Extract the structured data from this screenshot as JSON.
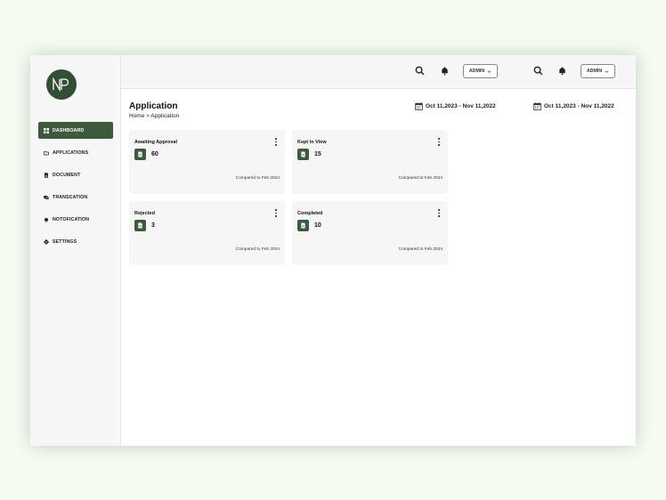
{
  "brand": {
    "logo_text": "NP",
    "accent_color": "#3d5a3c"
  },
  "sidebar": {
    "items": [
      {
        "label": "DASHBOARD",
        "icon": "dashboard-icon",
        "active": true
      },
      {
        "label": "APPLICATIONS",
        "icon": "folder-icon",
        "active": false
      },
      {
        "label": "DOCUMENT",
        "icon": "document-icon",
        "active": false
      },
      {
        "label": "TRANSCATION",
        "icon": "transaction-icon",
        "active": false
      },
      {
        "label": "NOTOFICATION",
        "icon": "bell-icon",
        "active": false
      },
      {
        "label": "SETTINGS",
        "icon": "gear-icon",
        "active": false
      }
    ]
  },
  "header": {
    "admin_label_1": "ADMIN",
    "admin_label_2": "ADMIN",
    "icons": [
      "search-icon",
      "bell-icon",
      "chevron-down-icon"
    ]
  },
  "page": {
    "title": "Application",
    "breadcrumb": "Home > Application",
    "date_range_1": "Oct 11,2023 - Nov 11,2022",
    "date_range_2": "Oct 11,2023 - Nov 11,2022"
  },
  "cards": [
    {
      "title": "Awaiting Approval",
      "value": "60",
      "compare": "Compared to Feb 2024"
    },
    {
      "title": "Kept in View",
      "value": "15",
      "compare": "Compared to Feb 2024"
    },
    {
      "title": "Rejected",
      "value": "3",
      "compare": "Compared to Feb 2024"
    },
    {
      "title": "Completed",
      "value": "10",
      "compare": "Compared to Feb 2024"
    }
  ]
}
